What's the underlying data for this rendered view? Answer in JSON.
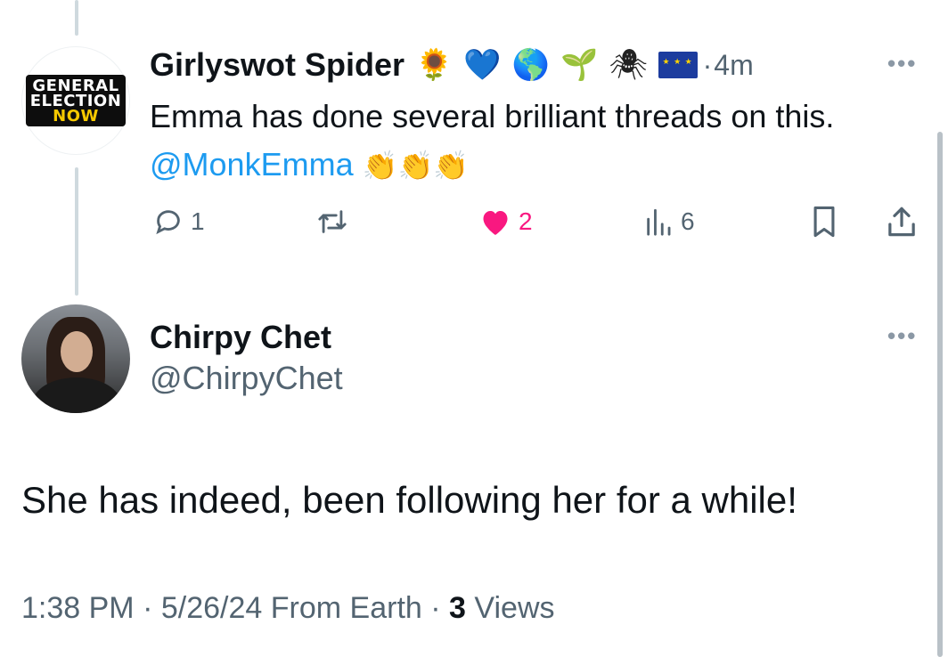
{
  "parent_tweet": {
    "author_name": "Girlyswot Spider",
    "avatar_logo_text": [
      "GENERAL",
      "ELECTION",
      "NOW"
    ],
    "name_emojis": [
      "🌻",
      "💙",
      "🌎",
      "🌱",
      "🕷",
      "🇪🇺"
    ],
    "time_separator": "·",
    "time": "4m",
    "text_main": "Emma has done several brilliant threads on this. ",
    "mention": "@MonkEmma",
    "text_emojis": "👏👏👏",
    "more_label": "•••",
    "actions": {
      "reply_count": "1",
      "retweet_count": "",
      "like_count": "2",
      "views_count": "6"
    }
  },
  "reply_tweet": {
    "author_name": "Chirpy Chet",
    "handle": "@ChirpyChet",
    "more_label": "•••",
    "text": "She has indeed, been following her for a while!",
    "meta": {
      "time": "1:38 PM",
      "date": "5/26/24",
      "source": "From Earth",
      "separator": "·",
      "views_count": "3",
      "views_label": "Views"
    }
  },
  "colors": {
    "text_primary": "#0f1419",
    "text_secondary": "#536471",
    "link": "#1d9bf0",
    "like": "#f91880",
    "thread_line": "#cfd9de"
  }
}
